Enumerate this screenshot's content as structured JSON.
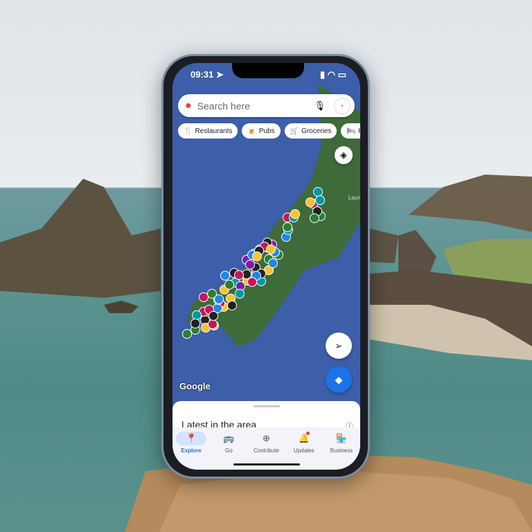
{
  "status_bar": {
    "time": "09:31",
    "icons": [
      "location-arrow-icon",
      "signal-icon",
      "wifi-icon",
      "battery-icon"
    ]
  },
  "search": {
    "placeholder": "Search here",
    "icons": [
      "google-maps-pin-icon",
      "microphone-icon",
      "profile-avatar"
    ]
  },
  "chips": [
    {
      "label": "Restaurants",
      "icon": "cutlery-icon"
    },
    {
      "label": "Pubs",
      "icon": "beer-mug-icon"
    },
    {
      "label": "Groceries",
      "icon": "cart-icon"
    },
    {
      "label": "Ho",
      "icon": "bed-icon"
    }
  ],
  "map": {
    "place_label": "Laun",
    "attribution": "Google",
    "pin_colors": [
      "#c2185b",
      "#fbc02d",
      "#0097a7",
      "#7b1fa2",
      "#2e7d32",
      "#1e88e5",
      "#212121"
    ],
    "water_color": "#3d5ea8",
    "land_color": "#3f6b3a"
  },
  "sheet": {
    "title": "Latest in the area"
  },
  "nav": {
    "items": [
      {
        "label": "Explore",
        "active": true
      },
      {
        "label": "Go"
      },
      {
        "label": "Contribute"
      },
      {
        "label": "Updates",
        "badge": true
      },
      {
        "label": "Business"
      }
    ]
  },
  "accent": "#1a73e8"
}
